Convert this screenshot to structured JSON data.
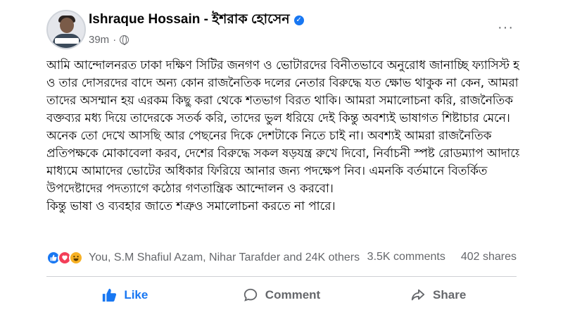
{
  "post": {
    "author": "Ishraque Hossain - ইশরাক হোসেন",
    "time": "39m",
    "separator": "·",
    "more_icon": "···",
    "body_lines": [
      "আমি আন্দোলনরত ঢাকা দক্ষিণ সিটির জনগণ ও ভোটারদের বিনীতভাবে অনুরোধ জানাচ্ছি ফ্যাসিস্ট হাসিনা",
      "ও তার দোসরদের বাদে অন্য কোন রাজনৈতিক দলের নেতার বিরুদ্ধে যত ক্ষোভ থাকুক না কেন, আমরা",
      "তাদের অসম্মান হয় এরকম কিছু করা থেকে শতভাগ বিরত থাকি। আমরা সমালোচনা করি, রাজনৈতিক",
      "বক্তব্যর মধ্য দিয়ে তাদেরকে সতর্ক করি, তাদের ভুল ধরিয়ে দেই কিন্তু অবশ্যই ভাষাগত শিষ্টাচার মেনে।",
      "অনেক তো দেখে আসছি আর পেছনের দিকে দেশটাকে নিতে চাই না। অবশ্যই আমরা রাজনৈতিক",
      "প্রতিপক্ষকে মোকাবেলা করব, দেশের বিরুদ্ধে সকল ষড়যন্ত্র রুখে দিবো, নির্বাচনী স্পষ্ট রোডম্যাপ আদায়ের",
      "মাধ্যমে আমাদের ভোটের অধিকার ফিরিয়ে আনার জন্য পদক্ষেপ নিব। এমনকি বর্তমানে বিতর্কিত",
      "উপদেষ্টাদের পদত্যাগে কঠোর গণতান্ত্রিক আন্দোলন ও করবো।",
      "কিন্তু ভাষা ও ব্যবহার জাতে শত্রুও সমালোচনা করতে না পারে।"
    ],
    "reactions_text": "You, S.M Shafiul Azam, Nihar Tarafder and 24K others",
    "comments": "3.5K comments",
    "shares": "402 shares",
    "actions": {
      "like": "Like",
      "comment": "Comment",
      "share": "Share"
    },
    "reaction_icons": [
      "like-reaction-icon",
      "love-reaction-icon",
      "haha-reaction-icon"
    ],
    "colors": {
      "accent": "#1877f2",
      "love": "#f33e58",
      "haha": "#f7b125",
      "muted": "#65676b"
    }
  }
}
